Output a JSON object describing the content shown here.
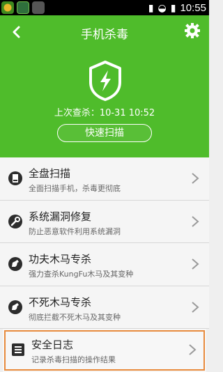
{
  "status_bar": {
    "time": "10:55",
    "icons": [
      "gameboy-icon",
      "ring-icon",
      "android-debug-icon",
      "signal-icon",
      "wifi-icon",
      "battery-icon"
    ]
  },
  "header": {
    "title": "手机杀毒",
    "last_scan": "上次查杀：10-31 10:52",
    "quick_scan": "快速扫描",
    "accent": "#4fbc2b"
  },
  "items": [
    {
      "title": "全盘扫描",
      "desc": "全面扫描手机，杀毒更彻底",
      "icon": "disk-scan-icon"
    },
    {
      "title": "系统漏洞修复",
      "desc": "防止恶意软件利用系统漏洞",
      "icon": "wrench-icon"
    },
    {
      "title": "功夫木马专杀",
      "desc": "强力查杀KungFu木马及其变种",
      "icon": "horse-icon"
    },
    {
      "title": "不死木马专杀",
      "desc": "彻底拦截不死木马及其变种",
      "icon": "horse-icon"
    },
    {
      "title": "安全日志",
      "desc": "记录杀毒扫描的操作结果",
      "icon": "log-icon"
    }
  ]
}
